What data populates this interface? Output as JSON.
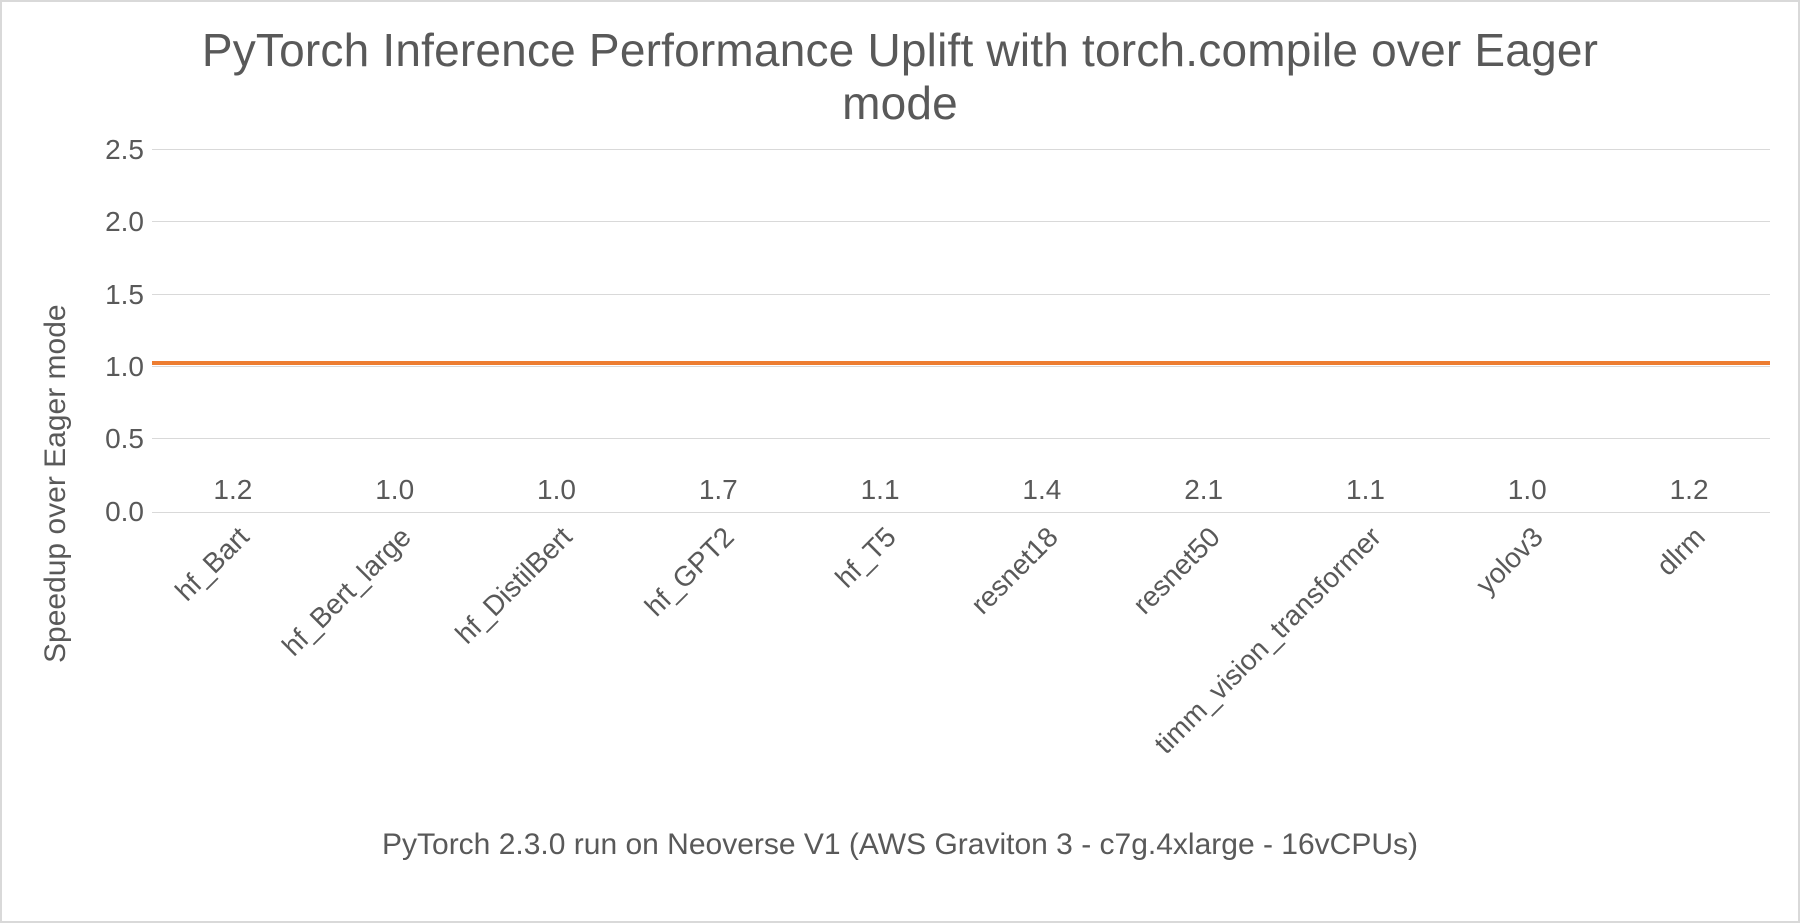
{
  "chart_data": {
    "type": "bar",
    "title": "PyTorch Inference Performance Uplift with torch.compile over Eager mode",
    "subtitle": "PyTorch 2.3.0 run on Neoverse V1 (AWS Graviton 3 - c7g.4xlarge - 16vCPUs)",
    "ylabel": "Speedup over Eager mode",
    "ylim": [
      0.0,
      2.5
    ],
    "yticks": [
      0.0,
      0.5,
      1.0,
      1.5,
      2.0,
      2.5
    ],
    "ytick_labels": [
      "0.0",
      "0.5",
      "1.0",
      "1.5",
      "2.0",
      "2.5"
    ],
    "reference_line": 1.0,
    "categories": [
      "hf_Bart",
      "hf_Bert_large",
      "hf_DistilBert",
      "hf_GPT2",
      "hf_T5",
      "resnet18",
      "resnet50",
      "timm_vision_transformer",
      "yolov3",
      "dlrm"
    ],
    "values": [
      1.2,
      1.0,
      1.0,
      1.7,
      1.1,
      1.4,
      2.1,
      1.1,
      1.0,
      1.2
    ],
    "value_labels": [
      "1.2",
      "1.0",
      "1.0",
      "1.7",
      "1.1",
      "1.4",
      "2.1",
      "1.1",
      "1.0",
      "1.2"
    ],
    "colors": {
      "bar": "#2e9bbf",
      "reference_line": "#ed7d31",
      "grid": "#d9d9d9"
    }
  }
}
